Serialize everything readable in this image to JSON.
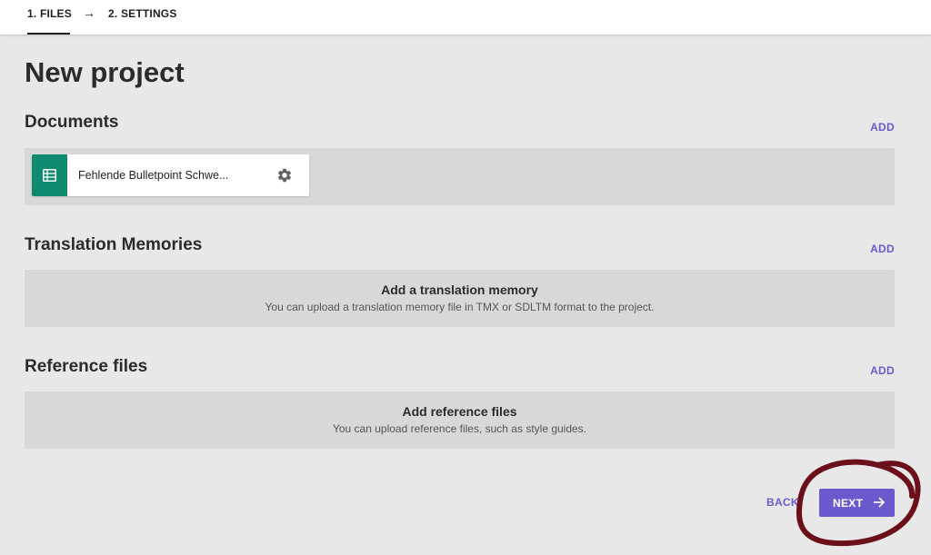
{
  "stepper": {
    "step1_label": "1. FILES",
    "arrow": "→",
    "step2_label": "2. SETTINGS"
  },
  "page": {
    "title": "New project"
  },
  "documents": {
    "title": "Documents",
    "add_label": "ADD",
    "items": [
      {
        "name": "Fehlende Bulletpoint Schwe...",
        "icon": "spreadsheet-icon",
        "settings_icon": "gear-icon"
      }
    ]
  },
  "translation_memories": {
    "title": "Translation Memories",
    "add_label": "ADD",
    "empty_title": "Add a translation memory",
    "empty_subtitle": "You can upload a translation memory file in TMX or SDLTM format to the project."
  },
  "reference_files": {
    "title": "Reference files",
    "add_label": "ADD",
    "empty_title": "Add reference files",
    "empty_subtitle": "You can upload reference files, such as style guides."
  },
  "footer": {
    "back_label": "BACK",
    "next_label": "NEXT",
    "next_icon": "arrow-right-icon"
  },
  "colors": {
    "accent": "#6a5acd",
    "doc_icon_bg": "#0f8a6e",
    "page_bg": "#e8e8e8",
    "panel_bg": "#d8d8d8",
    "annotation": "#6b0f1a"
  }
}
